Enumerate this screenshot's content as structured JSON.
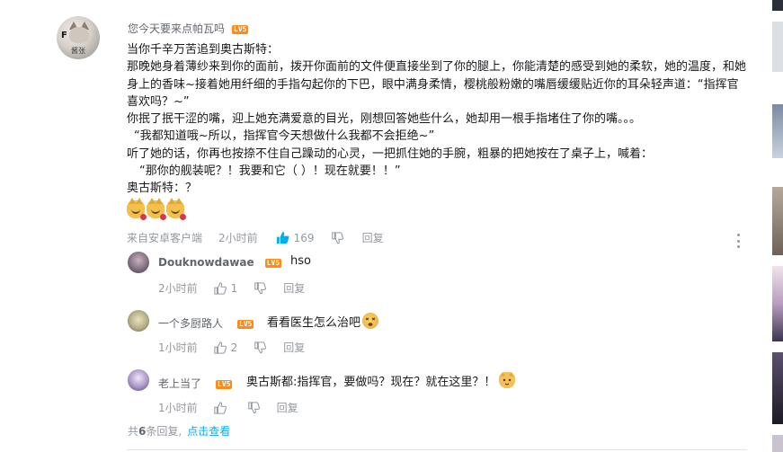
{
  "main_comment": {
    "username": "您今天要来点帕瓦吗",
    "level": "LV5",
    "avatar_caption": "酱张",
    "avatar_mark": "F",
    "lines": [
      "当你千辛万苦追到奥古斯特：",
      "那晚她身着薄纱来到你的面前，拨开你面前的文件便直接坐到了你的腿上，你能清楚的感受到她的柔软，她的温度，和她身上的香味~接着她用纤细的手指勾起你的下巴，眼中满身柔情，樱桃般粉嫩的嘴唇缓缓贴近你的耳朵轻声道：“指挥官喜欢吗？~”",
      "你抿了抿干涩的嘴，迎上她充满爱意的目光，刚想回答她些什么，她却用一根手指堵住了你的嘴。。。",
      "“我都知道哦~所以，指挥官今天想做什么我都不会拒绝~”",
      "听了她的话，你再也按捺不住自己躁动的心灵，一把抓住她的手腕，粗暴的把她按在了桌子上，喊着：",
      "“那你的舰装呢？！我要和它（    ）！现在就要！！”",
      "奥古斯特：？"
    ],
    "emoji_icons": [
      "cat-laugh-icon",
      "cat-laugh-icon",
      "cat-laugh-icon"
    ],
    "source": "来自安卓客户端",
    "time": "2小时前",
    "likes": "169",
    "reply_label": "回复"
  },
  "replies": [
    {
      "username": "Douknowdawae",
      "level": "LV5",
      "text": "hso",
      "time": "2小时前",
      "likes": "1",
      "reply_label": "回复",
      "avatar_color": "#8b7a8c"
    },
    {
      "username": "一个多厨路人",
      "level": "LV5",
      "text": "看看医生怎么治吧",
      "emoji": "dizzy-face-icon",
      "time": "1小时前",
      "likes": "2",
      "reply_label": "回复",
      "avatar_color": "#c9c39a"
    },
    {
      "username": "老上当了",
      "level": "LV5",
      "text": "奥古斯都:指挥官，要做吗？现在？就在这里？！",
      "emoji": "cat-face-icon",
      "time": "1小时前",
      "likes": "",
      "reply_label": "回复",
      "avatar_color": "#9a86b8"
    }
  ],
  "footer": {
    "prefix": "共",
    "count": "6",
    "suffix": "条回复,",
    "link": "点击查看"
  },
  "colors": {
    "level_badge": "#ff8a1a",
    "like_active": "#00aeec",
    "link": "#00aeec",
    "meta_text": "#9499a0"
  }
}
